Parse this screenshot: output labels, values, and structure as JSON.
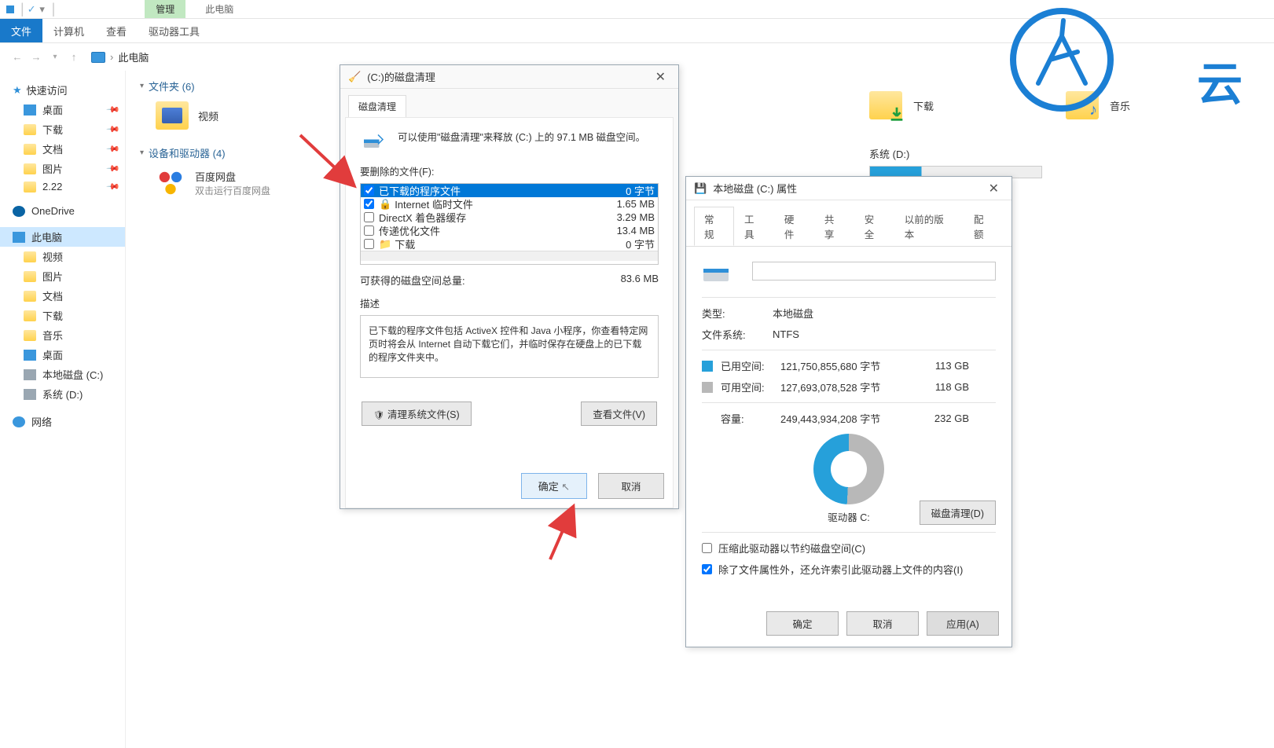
{
  "titlebar": {
    "manage": "管理",
    "thispc": "此电脑"
  },
  "ribbon": {
    "file": "文件",
    "computer": "计算机",
    "view": "查看",
    "drives": "驱动器工具"
  },
  "nav": {
    "location": "此电脑"
  },
  "sidebar": {
    "quick": "快速访问",
    "items": [
      {
        "label": "桌面"
      },
      {
        "label": "下载"
      },
      {
        "label": "文档"
      },
      {
        "label": "图片"
      },
      {
        "label": "2.22"
      }
    ],
    "onedrive": "OneDrive",
    "thispc": "此电脑",
    "pc_items": [
      {
        "label": "视频"
      },
      {
        "label": "图片"
      },
      {
        "label": "文档"
      },
      {
        "label": "下载"
      },
      {
        "label": "音乐"
      },
      {
        "label": "桌面"
      },
      {
        "label": "本地磁盘 (C:)"
      },
      {
        "label": "系统 (D:)"
      }
    ],
    "network": "网络"
  },
  "content": {
    "folders_hdr": "文件夹 (6)",
    "video": "视频",
    "devices_hdr": "设备和驱动器 (4)",
    "baidu": "百度网盘",
    "baidu_sub": "双击运行百度网盘",
    "downloads": "下载",
    "music": "音乐",
    "sysd": "系统 (D:)"
  },
  "cleanup": {
    "title": "(C:)的磁盘清理",
    "tab": "磁盘清理",
    "info": "可以使用\"磁盘清理\"来释放  (C:) 上的 97.1 MB 磁盘空间。",
    "files_label": "要删除的文件(F):",
    "rows": [
      {
        "name": "已下载的程序文件",
        "size": "0 字节",
        "checked": true,
        "sel": true
      },
      {
        "name": "Internet 临时文件",
        "size": "1.65 MB",
        "checked": true
      },
      {
        "name": "DirectX 着色器缓存",
        "size": "3.29 MB",
        "checked": false
      },
      {
        "name": "传递优化文件",
        "size": "13.4 MB",
        "checked": false
      },
      {
        "name": "下载",
        "size": "0 字节",
        "checked": false
      }
    ],
    "gain_label": "可获得的磁盘空间总量:",
    "gain_value": "83.6 MB",
    "desc_label": "描述",
    "desc": "已下载的程序文件包括 ActiveX 控件和 Java 小程序，你查看特定网页时将会从 Internet 自动下载它们，并临时保存在硬盘上的已下载的程序文件夹中。",
    "clean_sys": "清理系统文件(S)",
    "view_files": "查看文件(V)",
    "ok": "确定",
    "cancel": "取消"
  },
  "props": {
    "title": "本地磁盘 (C:) 属性",
    "tabs": [
      "常规",
      "工具",
      "硬件",
      "共享",
      "安全",
      "以前的版本",
      "配额"
    ],
    "type_k": "类型:",
    "type_v": "本地磁盘",
    "fs_k": "文件系统:",
    "fs_v": "NTFS",
    "used_k": "已用空间:",
    "used_b": "121,750,855,680 字节",
    "used_g": "113 GB",
    "free_k": "可用空间:",
    "free_b": "127,693,078,528 字节",
    "free_g": "118 GB",
    "cap_k": "容量:",
    "cap_b": "249,443,934,208 字节",
    "cap_g": "232 GB",
    "drive": "驱动器 C:",
    "disk_clean": "磁盘清理(D)",
    "compress": "压缩此驱动器以节约磁盘空间(C)",
    "index": "除了文件属性外，还允许索引此驱动器上文件的内容(I)",
    "ok": "确定",
    "cancel": "取消",
    "apply": "应用(A)"
  },
  "logo_text": "云"
}
